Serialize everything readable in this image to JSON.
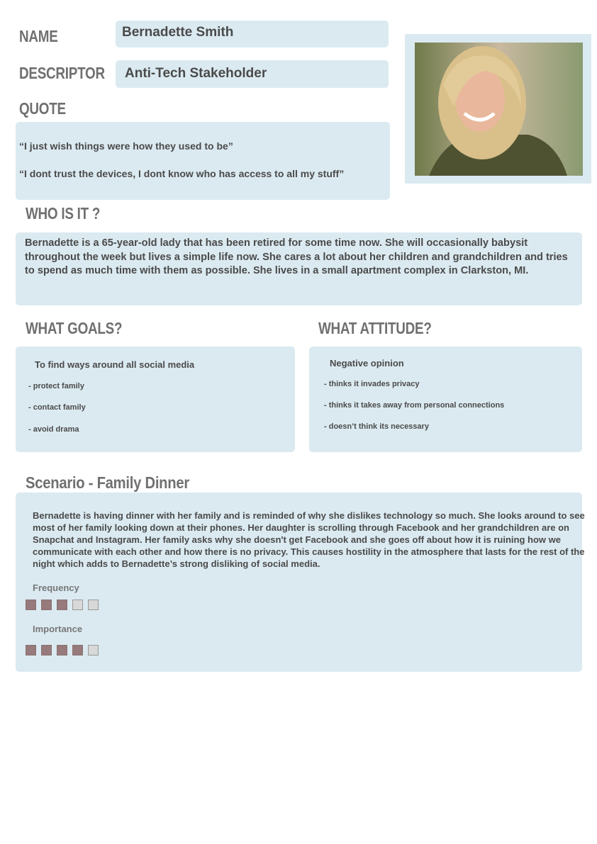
{
  "labels": {
    "name": "NAME",
    "descriptor": "DESCRIPTOR",
    "quote": "QUOTE",
    "who": "WHO IS IT ?",
    "goals": "WHAT GOALS?",
    "attitude": "WHAT ATTITUDE?"
  },
  "name": "Bernadette Smith",
  "descriptor": "Anti-Tech Stakeholder",
  "quotes": [
    "“I just wish things were how they used to be”",
    "“I dont trust the devices, I dont know who has access to all my stuff”"
  ],
  "who": "Bernadette is a 65-year-old lady that has been retired for some time now. She will occasionally babysit throughout the week but lives a simple life now. She cares a lot about her children and grandchildren and tries to spend as much time with them as possible. She lives in a small apartment complex in Clarkston, MI.",
  "goals": {
    "title": "To find ways around all social media",
    "items": [
      "- protect family",
      "- contact family",
      "- avoid drama"
    ]
  },
  "attitude": {
    "title": "Negative opinion",
    "items": [
      "- thinks it invades privacy",
      "- thinks it takes away from personal connections",
      "- doesn’t think its necessary"
    ]
  },
  "scenario": {
    "title": "Scenario - Family Dinner",
    "text": "Bernadette is having dinner with her family and is reminded of why she dislikes technology so much. She looks around to see most of her family looking down at their phones. Her daughter is scrolling through Facebook and her grandchildren are on Snapchat and Instagram. Her family asks why she doesn't get Facebook and she goes off about how it is ruining how we communicate with each other and how there is no privacy. This causes hostility in the atmosphere that lasts for the rest of the night which adds to Bernadette’s strong disliking of social media.",
    "frequency_label": "Frequency",
    "frequency": 3,
    "importance_label": "Importance",
    "importance": 4,
    "scale_max": 5
  },
  "colors": {
    "box": "#dbeaf1",
    "filled": "#977a7b",
    "empty": "#d8d8d8"
  }
}
